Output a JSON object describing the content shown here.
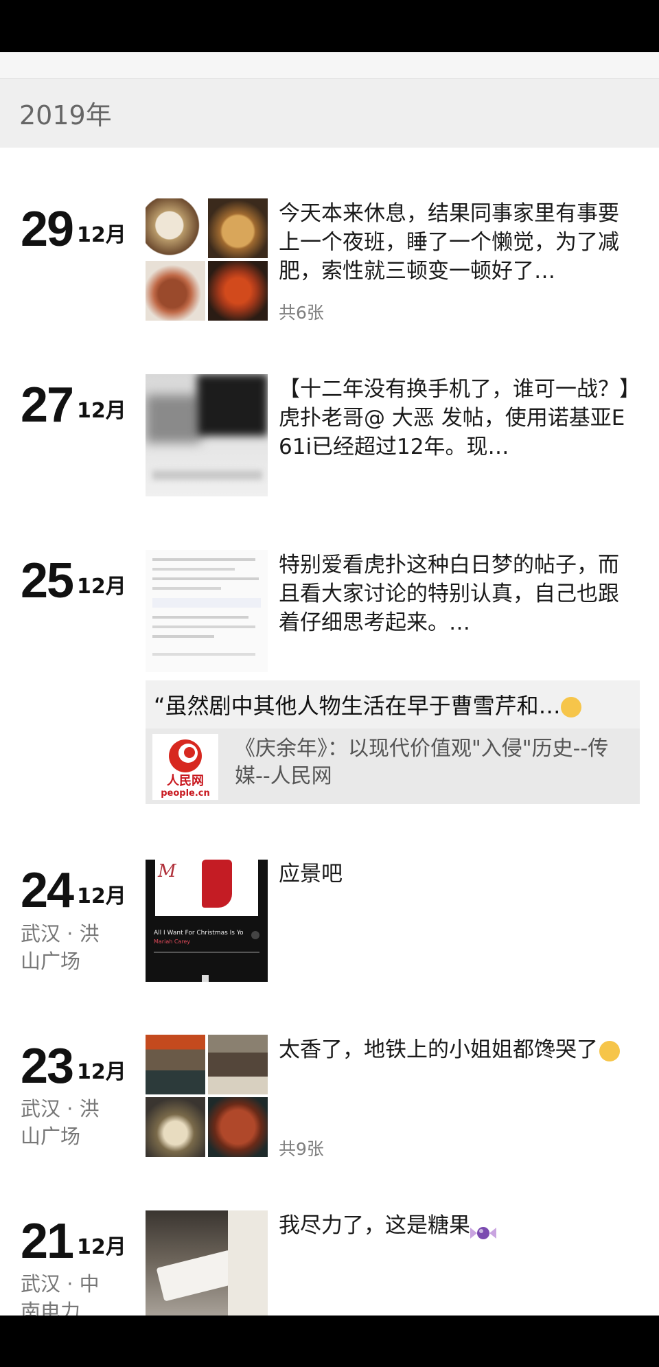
{
  "year_header": "2019年",
  "posts": [
    {
      "day": "29",
      "month": "12月",
      "location": "",
      "text": "今天本来休息，结果同事家里有事要上一个夜班，睡了一个懒觉，为了减肥，索性就三顿变一顿好了…",
      "photo_count": "共6张",
      "thumb_icon": "food-photo-grid"
    },
    {
      "day": "27",
      "month": "12月",
      "location": "",
      "text": "【十二年没有换手机了，谁可一战？】虎扑老哥@ 大恶 发帖，使用诺基亚E61i已经超过12年。现…",
      "photo_count": "",
      "thumb_icon": "blurred-phone-photo"
    },
    {
      "day": "25",
      "month": "12月",
      "location": "",
      "text": "特别爱看虎扑这种白日梦的帖子，而且看大家讨论的特别认真，自己也跟着仔细思考起来。…",
      "photo_count": "",
      "thumb_icon": "forum-screenshot"
    },
    {
      "day": "24",
      "month": "12月",
      "location": "武汉 · 洪山广场",
      "text": "应景吧",
      "photo_count": "",
      "thumb_icon": "music-player-screenshot"
    },
    {
      "day": "23",
      "month": "12月",
      "location": "武汉 · 洪山广场",
      "text": "太香了，地铁上的小姐姐都馋哭了",
      "photo_count": "共9张",
      "thumb_icon": "street-food-photo-grid"
    },
    {
      "day": "21",
      "month": "12月",
      "location": "武汉 · 中南电力",
      "text": "我尽力了，这是糖果",
      "photo_count": "",
      "thumb_icon": "candy-paper-photo"
    }
  ],
  "shared_link": {
    "quote": "“虽然剧中其他人物生活在早于曹雪芹和…",
    "title": "《庆余年》：以现代价值观\"入侵\"历史--传媒--人民网",
    "logo_text_cn": "人民网",
    "logo_text_en": "people.cn"
  },
  "music_card": {
    "song": "All I Want For Christmas Is Yo",
    "artist": "Mariah Carey"
  }
}
